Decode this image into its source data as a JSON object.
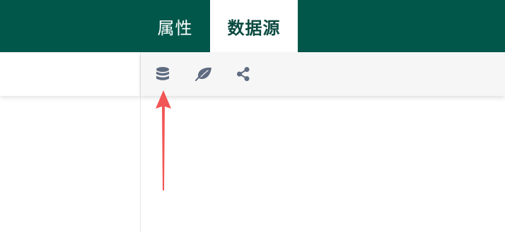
{
  "tabs": {
    "properties": "属性",
    "data_source": "数据源",
    "active": "data_source"
  },
  "toolbar": {
    "buttons": [
      {
        "icon": "database-icon"
      },
      {
        "icon": "leaf-icon"
      },
      {
        "icon": "share-icon"
      }
    ]
  },
  "colors": {
    "header_bg": "#02574b",
    "active_tab_text": "#0b4a40",
    "icon": "#5e6b80",
    "annotation_arrow": "#f25555"
  }
}
